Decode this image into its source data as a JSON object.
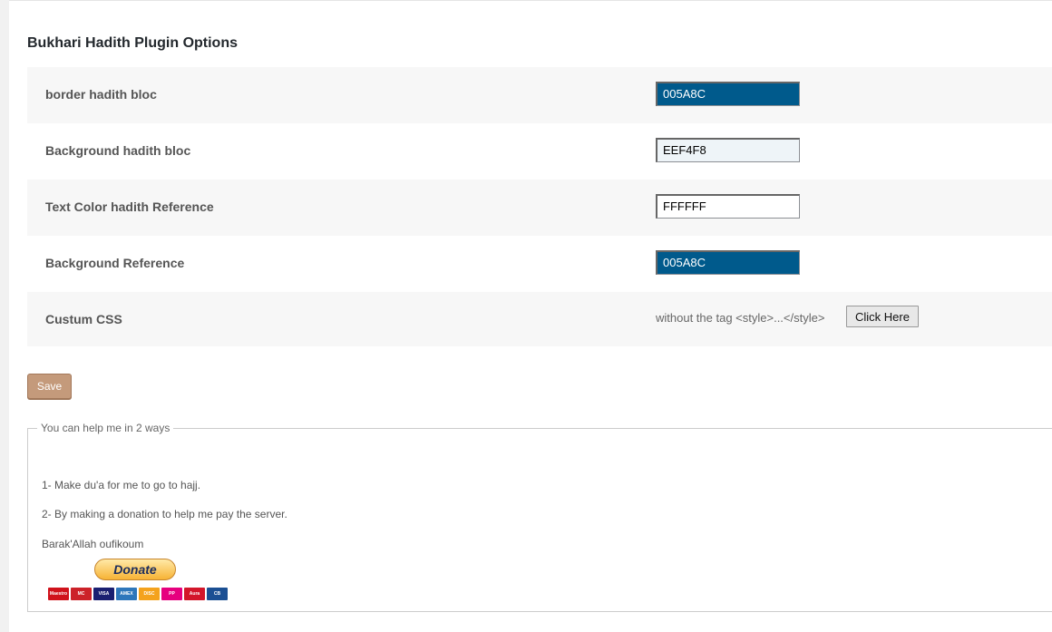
{
  "page": {
    "title": "Bukhari Hadith Plugin Options"
  },
  "options": [
    {
      "label": "border hadith bloc",
      "value": "005A8C",
      "bg": "#005A8C",
      "fg": "#ffffff"
    },
    {
      "label": "Background hadith bloc",
      "value": "EEF4F8",
      "bg": "#EEF4F8",
      "fg": "#000000"
    },
    {
      "label": "Text Color hadith Reference",
      "value": "FFFFFF",
      "bg": "#FFFFFF",
      "fg": "#000000"
    },
    {
      "label": "Background Reference",
      "value": "005A8C",
      "bg": "#005A8C",
      "fg": "#ffffff"
    }
  ],
  "custom_css": {
    "label": "Custum CSS",
    "hint": "without the tag <style>...</style>",
    "button": "Click Here"
  },
  "save": {
    "label": "Save"
  },
  "help": {
    "legend": "You can help me in 2 ways",
    "line1": "1- Make du'a for me to go to hajj.",
    "line2": "2- By making a donation to help me pay the server.",
    "line3": "Barak'Allah oufikoum",
    "donate": "Donate"
  },
  "cards": [
    {
      "name": "maestro-card-icon",
      "text": "Maestro",
      "color": "#d0121b"
    },
    {
      "name": "mastercard-icon",
      "text": "MC",
      "color": "#cc2229"
    },
    {
      "name": "visa-card-icon",
      "text": "VISA",
      "color": "#1a1f71"
    },
    {
      "name": "amex-card-icon",
      "text": "AMEX",
      "color": "#2e77bb"
    },
    {
      "name": "discover-card-icon",
      "text": "DISC",
      "color": "#f4a21d"
    },
    {
      "name": "postepay-card-icon",
      "text": "PP",
      "color": "#e6007e"
    },
    {
      "name": "aura-card-icon",
      "text": "Aura",
      "color": "#d3162a"
    },
    {
      "name": "cb-card-icon",
      "text": "CB",
      "color": "#1b4f93"
    }
  ]
}
